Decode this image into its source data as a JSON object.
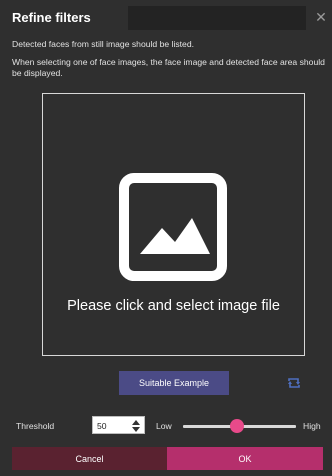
{
  "dialog": {
    "title": "Refine filters",
    "close_icon": "close-icon"
  },
  "description": {
    "line1": "Detected faces from still image should be listed.",
    "line2": "When selecting one of face images, the face image and detected face area should be displayed."
  },
  "dropzone": {
    "icon": "image-placeholder-icon",
    "prompt": "Please click and select image file"
  },
  "actions": {
    "example_label": "Suitable Example",
    "rotate_icon": "rotate-icon"
  },
  "threshold": {
    "label": "Threshold",
    "value": "50",
    "low_label": "Low",
    "high_label": "High",
    "slider_level": 0.48
  },
  "footer": {
    "cancel_label": "Cancel",
    "ok_label": "OK"
  },
  "colors": {
    "background": "#2f2f2f",
    "example_button": "#4b4b86",
    "cancel_button": "#5a2230",
    "ok_button": "#b52f6c",
    "slider_thumb": "#e84a8a"
  }
}
